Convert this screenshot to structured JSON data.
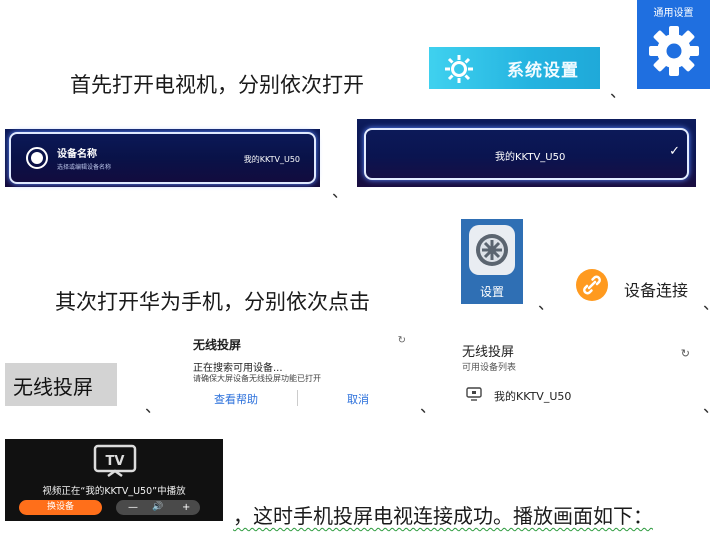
{
  "step1": {
    "text": "首先打开电视机，分别依次打开",
    "system_settings_label": "系统设置",
    "general_settings_label": "通用设置",
    "sep": "、"
  },
  "tv_panels": {
    "device_name_title": "设备名称",
    "device_name_hint": "选择或编辑设备名称",
    "device_name_value": "我的KKTV_U50",
    "selected_device": "我的KKTV_U50",
    "sep": "、"
  },
  "step2": {
    "text": "其次打开华为手机，分别依次点击",
    "settings_label": "设置",
    "device_connection_label": "设备连接",
    "sep": "、"
  },
  "wireless": {
    "tag_label": "无线投屏",
    "sep": "、"
  },
  "search_dialog": {
    "title": "无线投屏",
    "searching": "正在搜索可用设备...",
    "hint": "请确保大屏设备无线投屏功能已打开",
    "help_button": "查看帮助",
    "cancel_button": "取消"
  },
  "device_dialog": {
    "title": "无线投屏",
    "subtitle": "可用设备列表",
    "device": "我的KKTV_U50"
  },
  "playback": {
    "tv_label": "TV",
    "message": "视频正在“我的KKTV_U50”中播放",
    "switch_button": "换设备",
    "minus": "—",
    "volume_icon": "🔊",
    "plus": "+"
  },
  "final": {
    "text": "，这时手机投屏电视连接成功。播放画面如下："
  },
  "colors": {
    "system_bar": "#24b3e0",
    "general_tile": "#1f6fe0",
    "accent_orange": "#ff6f1a",
    "link_blue": "#2a6fdb"
  }
}
